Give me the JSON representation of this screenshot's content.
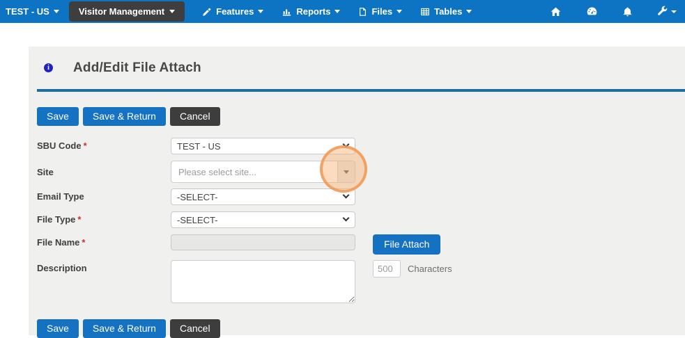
{
  "nav": {
    "brand": "TEST - US",
    "active_item": "Visitor Management",
    "items": [
      {
        "label": "Features",
        "icon": "pencil-icon"
      },
      {
        "label": "Reports",
        "icon": "bar-chart-icon"
      },
      {
        "label": "Files",
        "icon": "file-icon"
      },
      {
        "label": "Tables",
        "icon": "table-icon"
      }
    ],
    "right_icons": [
      "home-icon",
      "dashboard-icon",
      "bell-icon",
      "wrench-icon"
    ]
  },
  "page": {
    "title": "Add/Edit File Attach"
  },
  "toolbar": {
    "save_label": "Save",
    "save_return_label": "Save & Return",
    "cancel_label": "Cancel"
  },
  "form": {
    "sbu_code": {
      "label": "SBU Code",
      "required_mark": "*",
      "value": "TEST - US"
    },
    "site": {
      "label": "Site",
      "placeholder": "Please select site..."
    },
    "email_type": {
      "label": "Email Type",
      "value": "-SELECT-"
    },
    "file_type": {
      "label": "File Type",
      "required_mark": "*",
      "value": "-SELECT-"
    },
    "file_name": {
      "label": "File Name",
      "required_mark": "*",
      "value": ""
    },
    "file_attach_label": "File Attach",
    "description": {
      "label": "Description",
      "char_count": "500",
      "char_label": "Characters"
    }
  },
  "colors": {
    "nav_blue": "#0d74c4",
    "button_blue": "#1572c2",
    "button_dark": "#3d3d3d",
    "divider_blue": "#1f6e9e",
    "panel_gray": "#f0f0ef",
    "highlight_orange": "#f0944c"
  }
}
